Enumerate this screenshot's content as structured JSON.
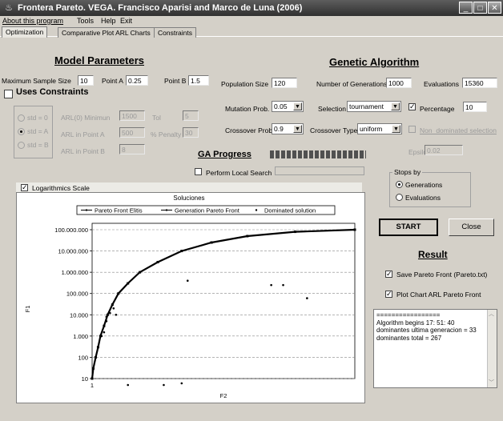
{
  "window": {
    "title": "Frontera Pareto. VEGA. Francisco Aparisi  and Marco de Luna (2006)",
    "app_icon": "app-icon"
  },
  "menu": [
    "About this program",
    "Tools",
    "Help",
    "Exit"
  ],
  "tabs": [
    "Optimization",
    "Comparative Plot ARL Charts",
    "Constraints"
  ],
  "model": {
    "heading": "Model Parameters",
    "max_sample_label": "Maximum Sample Size",
    "max_sample_value": "10",
    "point_a_label": "Point A",
    "point_a_value": "0.25",
    "point_b_label": "Point B",
    "point_b_value": "1.5",
    "use_constraints_label": "Uses Constraints",
    "radios": [
      "std = 0",
      "std = A",
      "std = B"
    ],
    "arl_min_label": "ARL(0) Minimun",
    "arl_min_value": "1500",
    "arl_a_label": "ARL in Point A",
    "arl_a_value": "500",
    "arl_b_label": "ARL in Point B",
    "arl_b_value": "8",
    "tol_label": "Tol",
    "tol_value": "5",
    "penalty_label": "% Penalty",
    "penalty_value": "30"
  },
  "ga": {
    "heading": "Genetic Algorithm",
    "pop_label": "Population Size",
    "pop_value": "120",
    "gens_label": "Number of Generations",
    "gens_value": "1000",
    "evals_label": "Evaluations",
    "evals_value": "15360",
    "mut_label": "Mutation Prob.",
    "mut_value": "0.05",
    "sel_label": "Selection",
    "sel_value": "tournament",
    "pct_label": "Percentage",
    "pct_value": "10",
    "cross_label": "Crossover Prob.",
    "cross_value": "0.9",
    "cross_type_label": "Crossover Type",
    "cross_type_value": "uniform",
    "nondom_label": "Non_dominated selection",
    "epsilon_label": "Epsilon",
    "epsilon_value": "0.02",
    "progress_label": "GA Progress",
    "progress_fraction": 1.0,
    "local_search_label": "Perform Local Search"
  },
  "stops": {
    "label": "Stops by",
    "options": [
      "Generations",
      "Evaluations"
    ],
    "selected": 0
  },
  "buttons": {
    "start": "START",
    "close": "Close"
  },
  "result": {
    "heading": "Result",
    "save_label": "Save Pareto Front (Pareto.txt)",
    "plot_label": "Plot Chart ARL Pareto Front",
    "log_lines": [
      "=================",
      "Algorithm begins 17: 51: 40",
      "dominantes ultima generacion = 33",
      "dominantes total = 267"
    ]
  },
  "chart_panel": {
    "log_scale_label": "Logarithmics Scale"
  },
  "chart_data": {
    "type": "scatter",
    "title": "Soluciones",
    "xlabel": "F2",
    "ylabel": "F1",
    "x_tick_labels": [
      "1"
    ],
    "y_tick_labels": [
      "100.000.000",
      "10.000.000",
      "1.000.000",
      "100.000",
      "10.000",
      "1.000",
      "100",
      "10"
    ],
    "y_log_scale": true,
    "ylim": [
      10,
      100000000
    ],
    "legend_position": "top",
    "series": [
      {
        "name": "Pareto Front Elitis",
        "style": "line",
        "values": [
          [
            1.0,
            10
          ],
          [
            1.01,
            30
          ],
          [
            1.03,
            100
          ],
          [
            1.05,
            300
          ],
          [
            1.07,
            1000
          ],
          [
            1.1,
            3000
          ],
          [
            1.13,
            10000
          ],
          [
            1.17,
            30000
          ],
          [
            1.22,
            100000
          ],
          [
            1.3,
            300000
          ],
          [
            1.4,
            1000000
          ],
          [
            1.55,
            3000000
          ],
          [
            1.75,
            10000000
          ],
          [
            2.0,
            25000000
          ],
          [
            2.3,
            50000000
          ],
          [
            2.7,
            80000000
          ],
          [
            3.2,
            100000000
          ]
        ]
      },
      {
        "name": "Generation Pareto Front",
        "style": "line",
        "values": []
      },
      {
        "name": "Dominated solution",
        "style": "dots",
        "values": [
          [
            1.0,
            10
          ],
          [
            1.08,
            1000
          ],
          [
            1.1,
            1500
          ],
          [
            1.12,
            5000
          ],
          [
            1.12,
            8000
          ],
          [
            1.15,
            12000
          ],
          [
            1.18,
            20000
          ],
          [
            1.2,
            10000
          ],
          [
            1.3,
            5
          ],
          [
            1.6,
            5
          ],
          [
            1.75,
            6
          ],
          [
            1.8,
            400000
          ],
          [
            2.5,
            250000
          ],
          [
            2.6,
            250000
          ],
          [
            2.8,
            60000
          ]
        ]
      }
    ]
  }
}
